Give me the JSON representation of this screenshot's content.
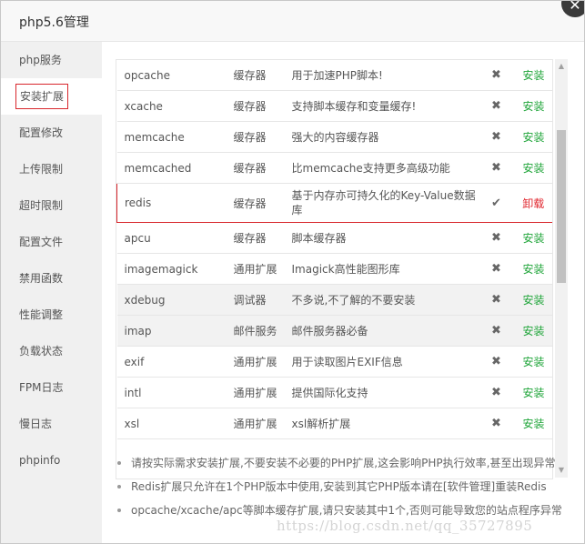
{
  "window": {
    "title": "php5.6管理"
  },
  "sidebar": {
    "items": [
      {
        "label": "php服务"
      },
      {
        "label": "安装扩展",
        "active": true
      },
      {
        "label": "配置修改"
      },
      {
        "label": "上传限制"
      },
      {
        "label": "超时限制"
      },
      {
        "label": "配置文件"
      },
      {
        "label": "禁用函数"
      },
      {
        "label": "性能调整"
      },
      {
        "label": "负载状态"
      },
      {
        "label": "FPM日志"
      },
      {
        "label": "慢日志"
      },
      {
        "label": "phpinfo"
      }
    ]
  },
  "extensions": [
    {
      "name": "opcache",
      "type": "缓存器",
      "desc": "用于加速PHP脚本!",
      "status": "✖",
      "action": "安装"
    },
    {
      "name": "xcache",
      "type": "缓存器",
      "desc": "支持脚本缓存和变量缓存!",
      "status": "✖",
      "action": "安装"
    },
    {
      "name": "memcache",
      "type": "缓存器",
      "desc": "强大的内容缓存器",
      "status": "✖",
      "action": "安装"
    },
    {
      "name": "memcached",
      "type": "缓存器",
      "desc": "比memcache支持更多高级功能",
      "status": "✖",
      "action": "安装"
    },
    {
      "name": "redis",
      "type": "缓存器",
      "desc": "基于内存亦可持久化的Key-Value数据库",
      "status": "✔",
      "action": "卸载",
      "installed": true
    },
    {
      "name": "apcu",
      "type": "缓存器",
      "desc": "脚本缓存器",
      "status": "✖",
      "action": "安装"
    },
    {
      "name": "imagemagick",
      "type": "通用扩展",
      "desc": "Imagick高性能图形库",
      "status": "✖",
      "action": "安装"
    },
    {
      "name": "xdebug",
      "type": "调试器",
      "desc": "不多说,不了解的不要安装",
      "status": "✖",
      "action": "安装"
    },
    {
      "name": "imap",
      "type": "邮件服务",
      "desc": "邮件服务器必备",
      "status": "✖",
      "action": "安装"
    },
    {
      "name": "exif",
      "type": "通用扩展",
      "desc": "用于读取图片EXIF信息",
      "status": "✖",
      "action": "安装"
    },
    {
      "name": "intl",
      "type": "通用扩展",
      "desc": "提供国际化支持",
      "status": "✖",
      "action": "安装"
    },
    {
      "name": "xsl",
      "type": "通用扩展",
      "desc": "xsl解析扩展",
      "status": "✖",
      "action": "安装"
    }
  ],
  "notes": [
    "请按实际需求安装扩展,不要安装不必要的PHP扩展,这会影响PHP执行效率,甚至出现异常",
    "Redis扩展只允许在1个PHP版本中使用,安装到其它PHP版本请在[软件管理]重装Redis",
    "opcache/xcache/apc等脚本缓存扩展,请只安装其中1个,否则可能导致您的站点程序异常"
  ],
  "watermark": "https://blog.csdn.net/qq_35727895",
  "colors": {
    "install": "#20a53a",
    "uninstall": "#e0242c",
    "highlight": "#d8262c"
  }
}
